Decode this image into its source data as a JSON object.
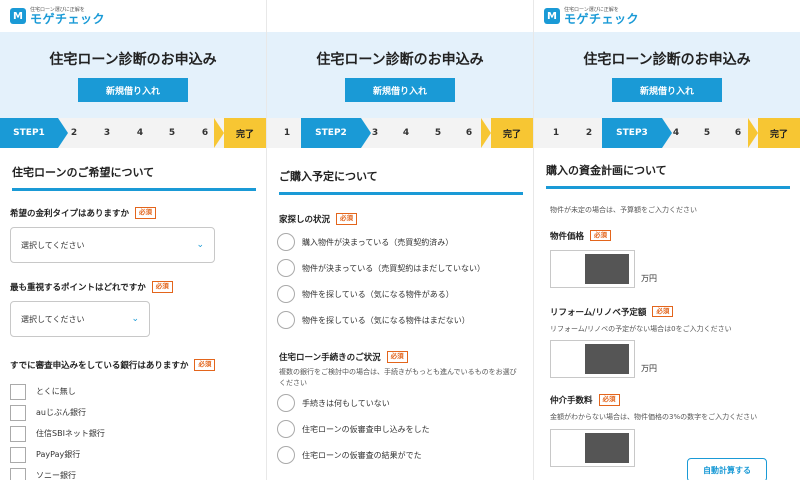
{
  "logo": {
    "tagline": "住宅ローン選びに正解を",
    "name": "モゲチェック",
    "mark": "M"
  },
  "hero": {
    "title": "住宅ローン診断のお申込み",
    "button": "新規借り入れ"
  },
  "steps": {
    "numbers": [
      "1",
      "2",
      "3",
      "4",
      "5",
      "6"
    ],
    "step_labels": [
      "STEP1",
      "STEP2",
      "STEP3"
    ],
    "done": "完了"
  },
  "required": "必須",
  "panel1": {
    "section_title": "住宅ローンのご希望について",
    "q1": {
      "label": "希望の金利タイプはありますか",
      "select_value": "選択してください"
    },
    "q2": {
      "label": "最も重視するポイントはどれですか",
      "select_value": "選択してください"
    },
    "q3": {
      "label": "すでに審査申込みをしている銀行はありますか",
      "options": [
        "とくに無し",
        "auじぶん銀行",
        "住信SBIネット銀行",
        "PayPay銀行",
        "ソニー銀行"
      ]
    }
  },
  "panel2": {
    "section_title": "ご購入予定について",
    "q1": {
      "label": "家探しの状況",
      "options": [
        "購入物件が決まっている（売買契約済み）",
        "物件が決まっている（売買契約はまだしていない）",
        "物件を探している（気になる物件がある）",
        "物件を探している（気になる物件はまだない）"
      ]
    },
    "q2": {
      "label": "住宅ローン手続きのご状況",
      "hint": "複数の銀行をご検討中の場合は、手続きがもっとも進んでいるものをお選びください",
      "options": [
        "手続きは何もしていない",
        "住宅ローンの仮審査申し込みをした",
        "住宅ローンの仮審査の結果がでた"
      ]
    }
  },
  "panel3": {
    "section_title": "購入の資金計画について",
    "intro": "物件が未定の場合は、予算額をご入力ください",
    "price": {
      "label": "物件価格",
      "unit": "万円"
    },
    "reform": {
      "label": "リフォーム/リノベ予定額",
      "hint": "リフォーム/リノベの予定がない場合は0をご入力ください",
      "unit": "万円"
    },
    "fee": {
      "label": "仲介手数料",
      "hint": "金額がわからない場合は、物件価格の3%の数字をご入力ください",
      "auto_button": "自動計算する"
    }
  }
}
